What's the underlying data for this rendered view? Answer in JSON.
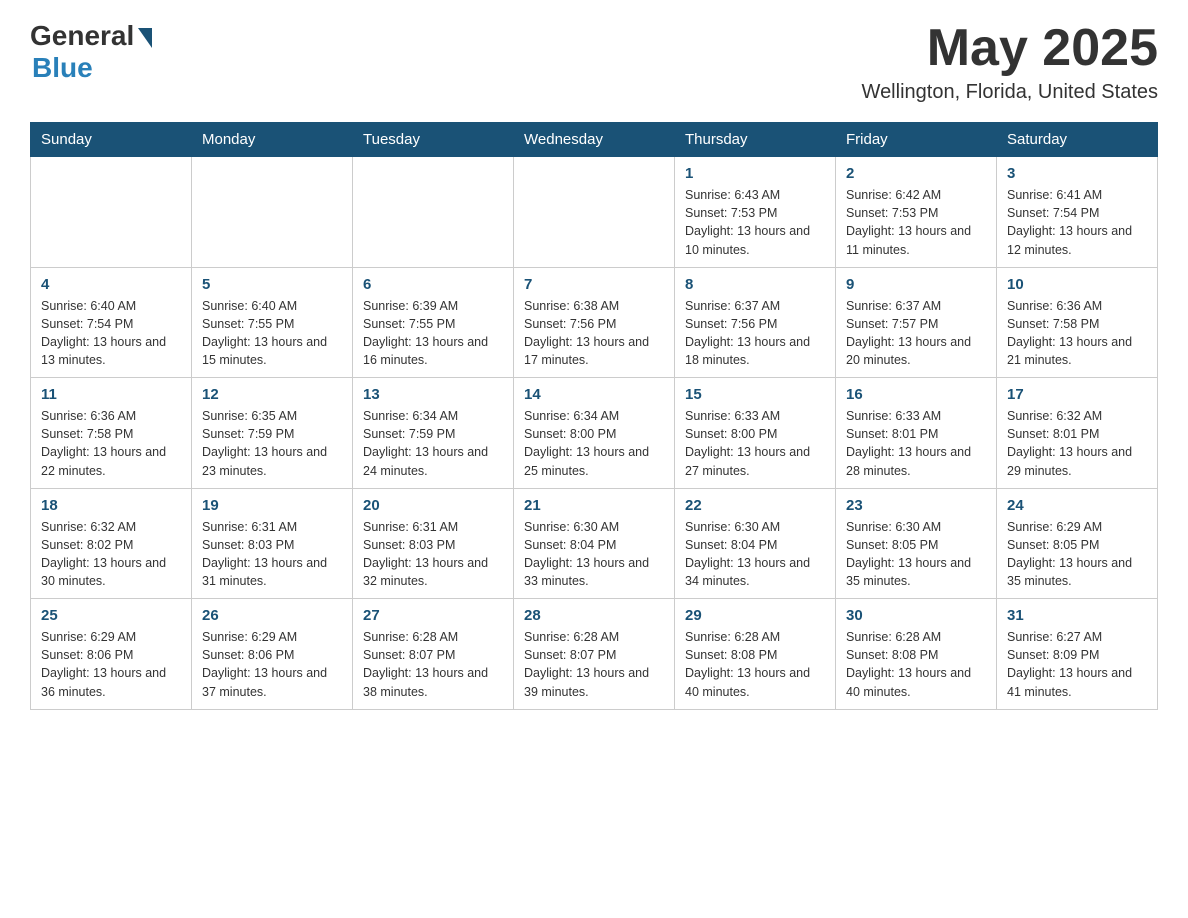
{
  "header": {
    "logo_general": "General",
    "logo_blue": "Blue",
    "month_year": "May 2025",
    "location": "Wellington, Florida, United States"
  },
  "days_of_week": [
    "Sunday",
    "Monday",
    "Tuesday",
    "Wednesday",
    "Thursday",
    "Friday",
    "Saturday"
  ],
  "weeks": [
    [
      {
        "day": "",
        "info": ""
      },
      {
        "day": "",
        "info": ""
      },
      {
        "day": "",
        "info": ""
      },
      {
        "day": "",
        "info": ""
      },
      {
        "day": "1",
        "info": "Sunrise: 6:43 AM\nSunset: 7:53 PM\nDaylight: 13 hours and 10 minutes."
      },
      {
        "day": "2",
        "info": "Sunrise: 6:42 AM\nSunset: 7:53 PM\nDaylight: 13 hours and 11 minutes."
      },
      {
        "day": "3",
        "info": "Sunrise: 6:41 AM\nSunset: 7:54 PM\nDaylight: 13 hours and 12 minutes."
      }
    ],
    [
      {
        "day": "4",
        "info": "Sunrise: 6:40 AM\nSunset: 7:54 PM\nDaylight: 13 hours and 13 minutes."
      },
      {
        "day": "5",
        "info": "Sunrise: 6:40 AM\nSunset: 7:55 PM\nDaylight: 13 hours and 15 minutes."
      },
      {
        "day": "6",
        "info": "Sunrise: 6:39 AM\nSunset: 7:55 PM\nDaylight: 13 hours and 16 minutes."
      },
      {
        "day": "7",
        "info": "Sunrise: 6:38 AM\nSunset: 7:56 PM\nDaylight: 13 hours and 17 minutes."
      },
      {
        "day": "8",
        "info": "Sunrise: 6:37 AM\nSunset: 7:56 PM\nDaylight: 13 hours and 18 minutes."
      },
      {
        "day": "9",
        "info": "Sunrise: 6:37 AM\nSunset: 7:57 PM\nDaylight: 13 hours and 20 minutes."
      },
      {
        "day": "10",
        "info": "Sunrise: 6:36 AM\nSunset: 7:58 PM\nDaylight: 13 hours and 21 minutes."
      }
    ],
    [
      {
        "day": "11",
        "info": "Sunrise: 6:36 AM\nSunset: 7:58 PM\nDaylight: 13 hours and 22 minutes."
      },
      {
        "day": "12",
        "info": "Sunrise: 6:35 AM\nSunset: 7:59 PM\nDaylight: 13 hours and 23 minutes."
      },
      {
        "day": "13",
        "info": "Sunrise: 6:34 AM\nSunset: 7:59 PM\nDaylight: 13 hours and 24 minutes."
      },
      {
        "day": "14",
        "info": "Sunrise: 6:34 AM\nSunset: 8:00 PM\nDaylight: 13 hours and 25 minutes."
      },
      {
        "day": "15",
        "info": "Sunrise: 6:33 AM\nSunset: 8:00 PM\nDaylight: 13 hours and 27 minutes."
      },
      {
        "day": "16",
        "info": "Sunrise: 6:33 AM\nSunset: 8:01 PM\nDaylight: 13 hours and 28 minutes."
      },
      {
        "day": "17",
        "info": "Sunrise: 6:32 AM\nSunset: 8:01 PM\nDaylight: 13 hours and 29 minutes."
      }
    ],
    [
      {
        "day": "18",
        "info": "Sunrise: 6:32 AM\nSunset: 8:02 PM\nDaylight: 13 hours and 30 minutes."
      },
      {
        "day": "19",
        "info": "Sunrise: 6:31 AM\nSunset: 8:03 PM\nDaylight: 13 hours and 31 minutes."
      },
      {
        "day": "20",
        "info": "Sunrise: 6:31 AM\nSunset: 8:03 PM\nDaylight: 13 hours and 32 minutes."
      },
      {
        "day": "21",
        "info": "Sunrise: 6:30 AM\nSunset: 8:04 PM\nDaylight: 13 hours and 33 minutes."
      },
      {
        "day": "22",
        "info": "Sunrise: 6:30 AM\nSunset: 8:04 PM\nDaylight: 13 hours and 34 minutes."
      },
      {
        "day": "23",
        "info": "Sunrise: 6:30 AM\nSunset: 8:05 PM\nDaylight: 13 hours and 35 minutes."
      },
      {
        "day": "24",
        "info": "Sunrise: 6:29 AM\nSunset: 8:05 PM\nDaylight: 13 hours and 35 minutes."
      }
    ],
    [
      {
        "day": "25",
        "info": "Sunrise: 6:29 AM\nSunset: 8:06 PM\nDaylight: 13 hours and 36 minutes."
      },
      {
        "day": "26",
        "info": "Sunrise: 6:29 AM\nSunset: 8:06 PM\nDaylight: 13 hours and 37 minutes."
      },
      {
        "day": "27",
        "info": "Sunrise: 6:28 AM\nSunset: 8:07 PM\nDaylight: 13 hours and 38 minutes."
      },
      {
        "day": "28",
        "info": "Sunrise: 6:28 AM\nSunset: 8:07 PM\nDaylight: 13 hours and 39 minutes."
      },
      {
        "day": "29",
        "info": "Sunrise: 6:28 AM\nSunset: 8:08 PM\nDaylight: 13 hours and 40 minutes."
      },
      {
        "day": "30",
        "info": "Sunrise: 6:28 AM\nSunset: 8:08 PM\nDaylight: 13 hours and 40 minutes."
      },
      {
        "day": "31",
        "info": "Sunrise: 6:27 AM\nSunset: 8:09 PM\nDaylight: 13 hours and 41 minutes."
      }
    ]
  ]
}
